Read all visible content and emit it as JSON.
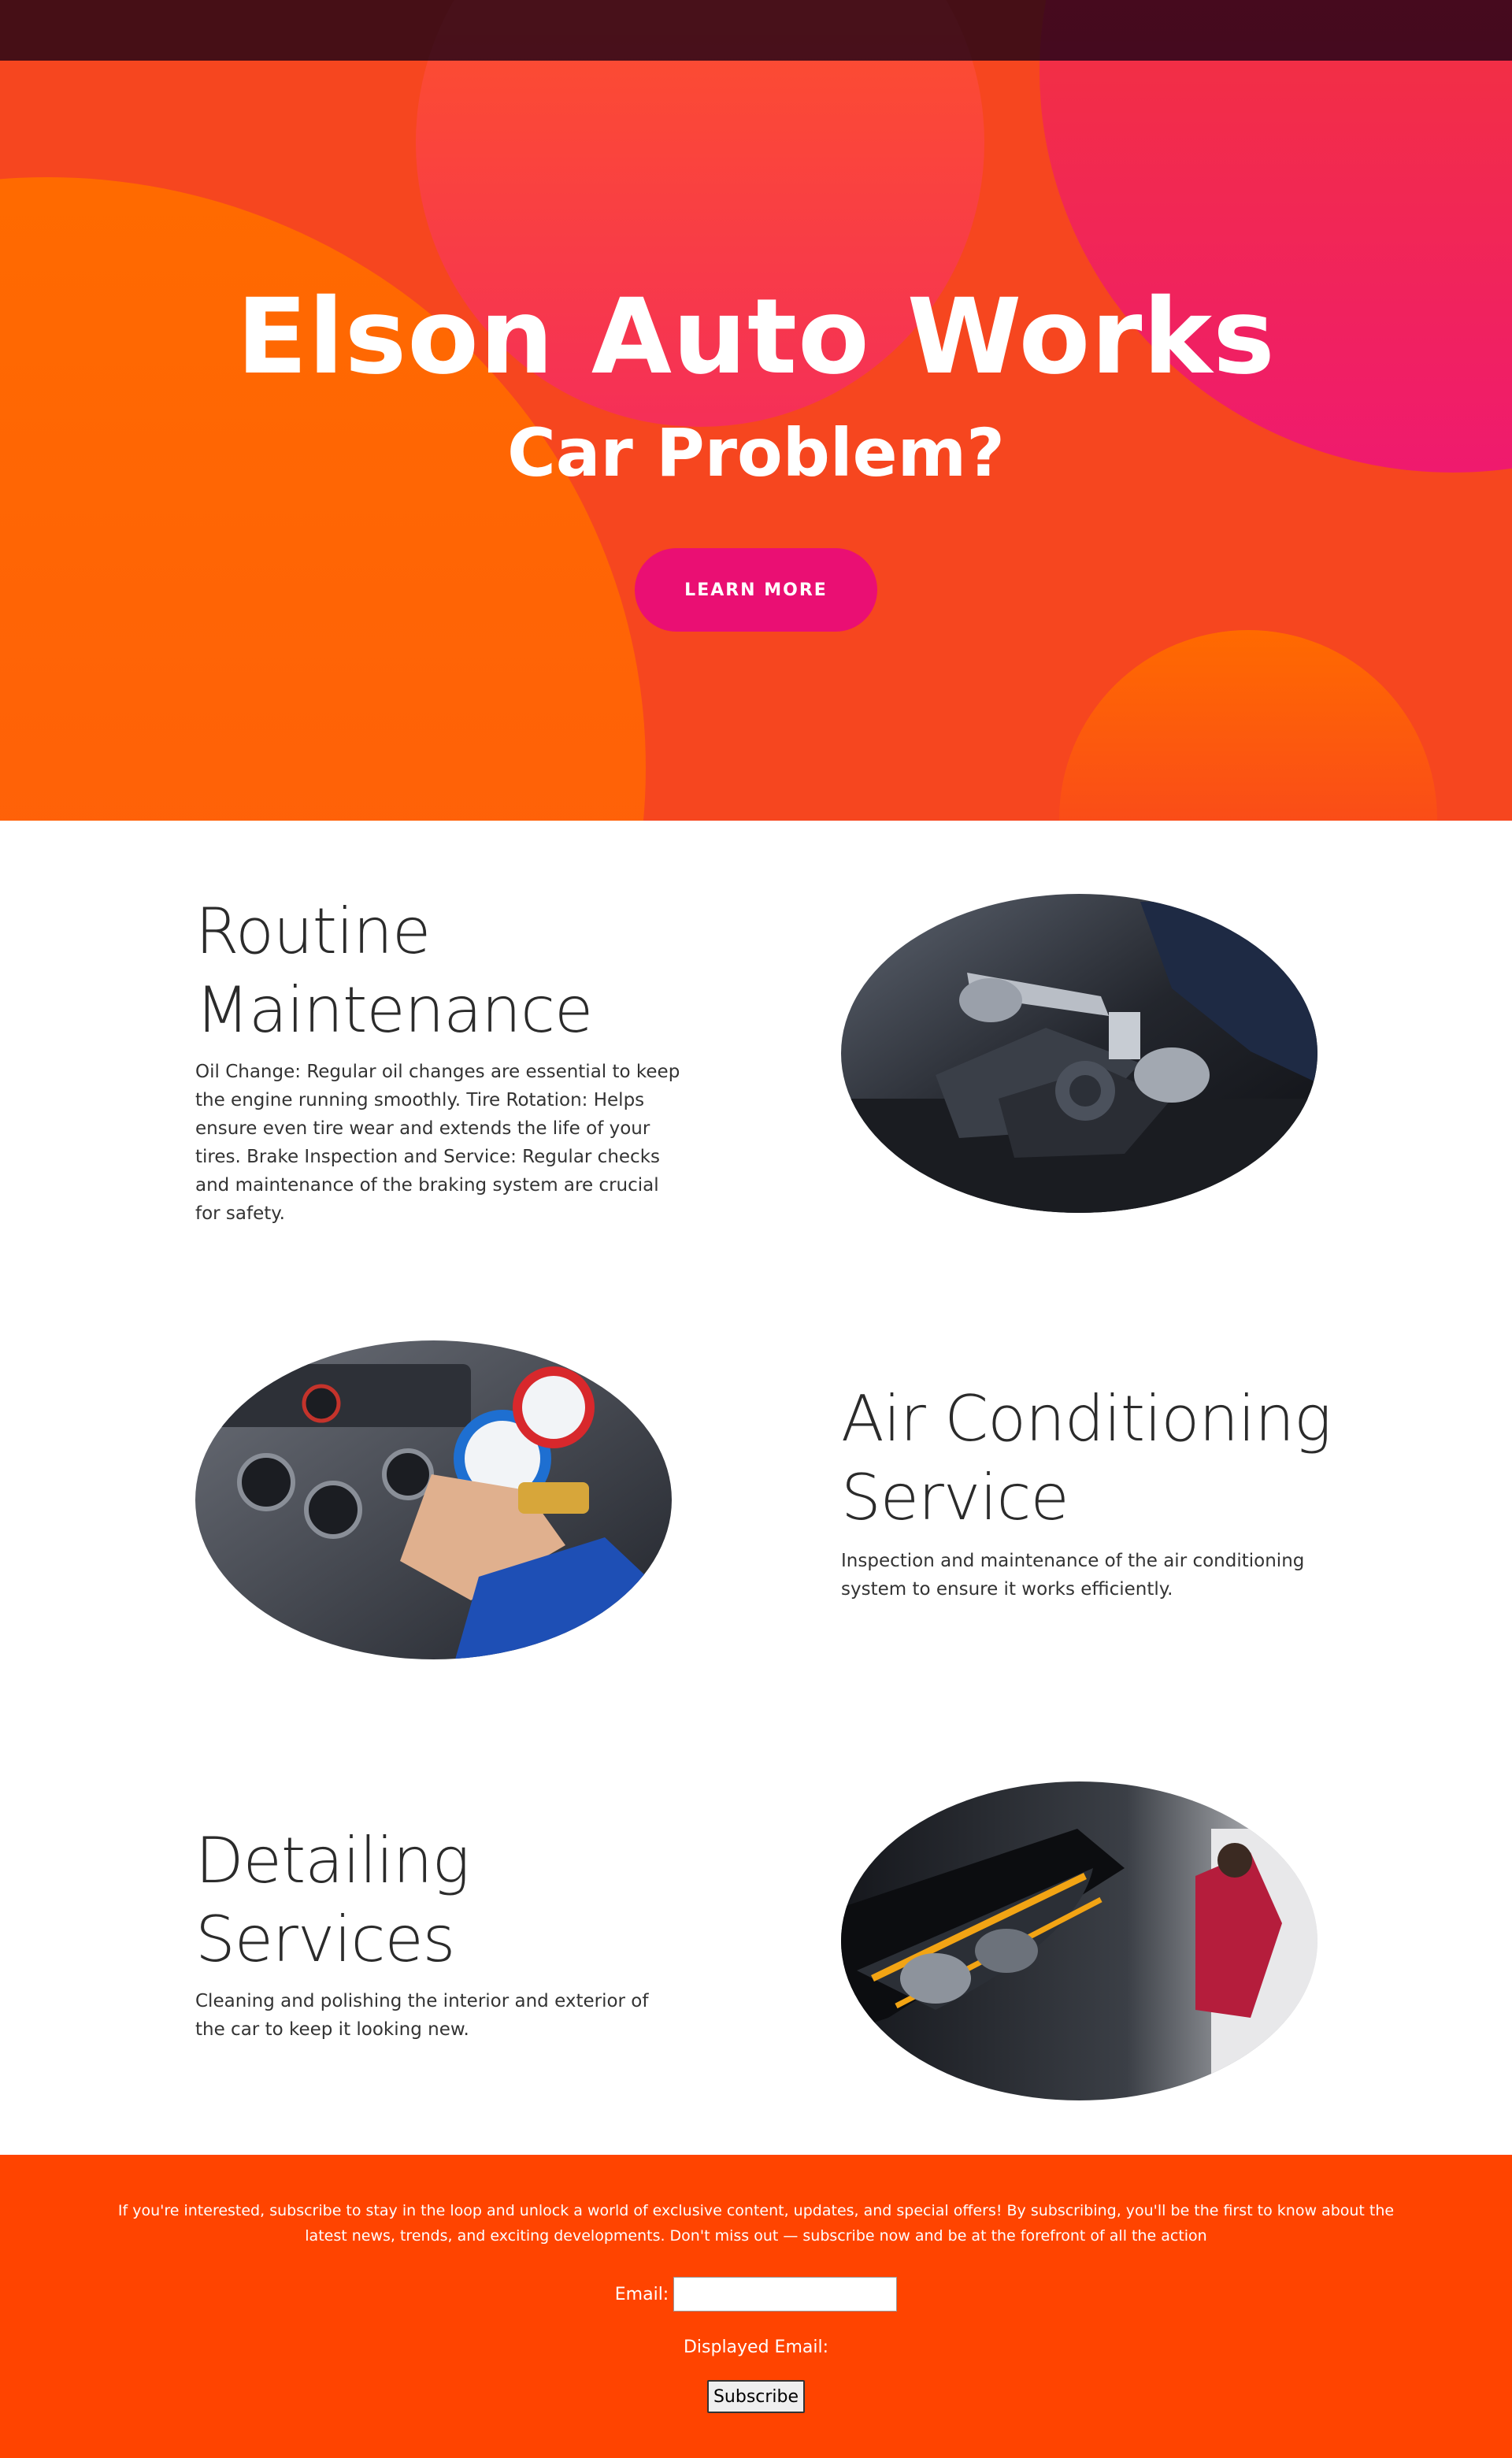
{
  "hero": {
    "title": "Elson Auto Works",
    "subtitle": "Car Problem?",
    "cta_label": "LEARN MORE",
    "colors": {
      "primary_orange": "#ff5a0e",
      "magenta": "#ea0f73",
      "top_band": "#2a0016"
    }
  },
  "services": [
    {
      "title_line1": "Routine",
      "title_line2": "Maintenance",
      "text": "Oil Change: Regular oil changes are essential to keep the engine running smoothly. Tire Rotation: Helps ensure even tire wear and extends the life of your tires. Brake Inspection and Service: Regular checks and maintenance of the braking system are crucial for safety.",
      "image_subject": "mechanic-engine-photo"
    },
    {
      "title_line1": "Air Conditioning",
      "title_line2": "Service",
      "text": "Inspection and maintenance of the air conditioning system to ensure it works efficiently.",
      "image_subject": "ac-gauge-photo"
    },
    {
      "title_line1": "Detailing",
      "title_line2": "Services",
      "text": "Cleaning and polishing the interior and exterior of the car to keep it looking new.",
      "image_subject": "car-headlight-detailing-photo"
    }
  ],
  "subscribe": {
    "blurb": "If you're interested, subscribe to stay in the loop and unlock a world of exclusive content, updates, and special offers! By subscribing, you'll be the first to know about the latest news, trends, and exciting developments. Don't miss out — subscribe now and be at the forefront of all the action",
    "email_label": "Email:",
    "email_value": "",
    "displayed_email_label": "Displayed Email:",
    "button_label": "Subscribe",
    "background_color": "#ff4400"
  }
}
